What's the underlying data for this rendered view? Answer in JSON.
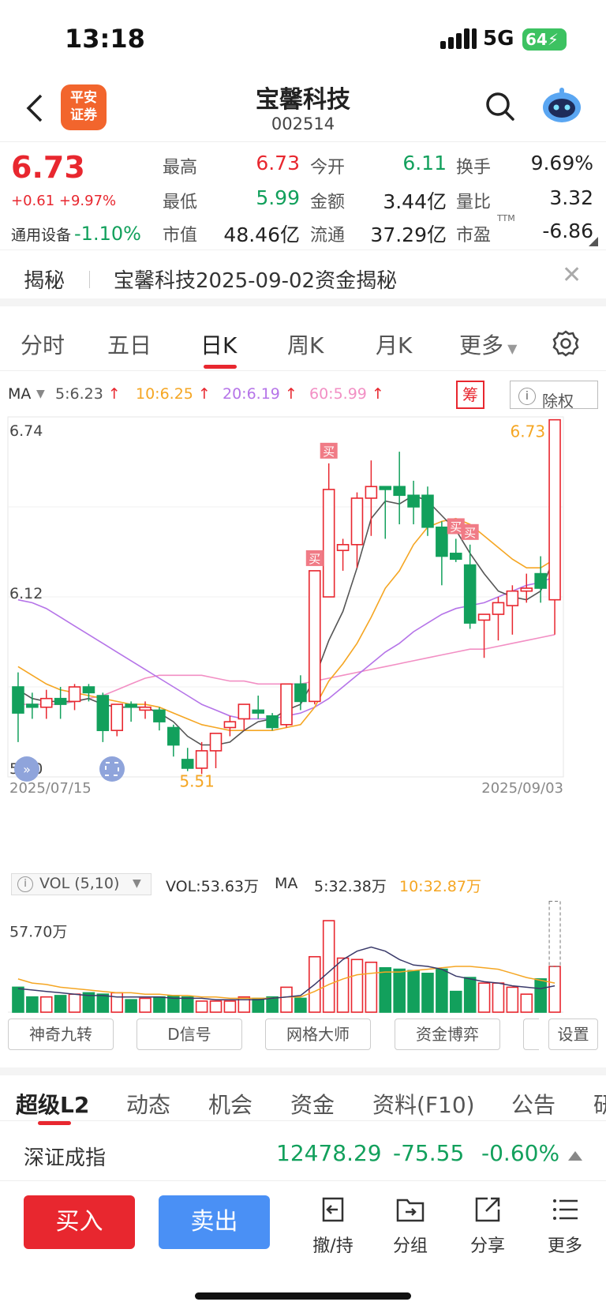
{
  "status": {
    "time": "13:18",
    "network": "5G",
    "battery": "64"
  },
  "header": {
    "logo_line1": "平安",
    "logo_line2": "证券",
    "title": "宝馨科技",
    "code": "002514"
  },
  "quote": {
    "price": "6.73",
    "change": "+0.61 +9.97%",
    "sector_name": "通用设备",
    "sector_change": "-1.10%",
    "rows": [
      [
        {
          "label": "最高",
          "value": "6.73",
          "color": "red"
        },
        {
          "label": "今开",
          "value": "6.11",
          "color": "green"
        },
        {
          "label": "换手",
          "value": "9.69%",
          "color": "black"
        }
      ],
      [
        {
          "label": "最低",
          "value": "5.99",
          "color": "green"
        },
        {
          "label": "金额",
          "value": "3.44亿",
          "color": "black"
        },
        {
          "label": "量比",
          "value": "3.32",
          "color": "black"
        }
      ],
      [
        {
          "label": "市值",
          "value": "48.46亿",
          "color": "black"
        },
        {
          "label": "流通",
          "value": "37.29亿",
          "color": "black"
        },
        {
          "label": "市盈",
          "value": "-6.86",
          "color": "black"
        }
      ]
    ],
    "pe_sup": "TTM"
  },
  "reveal": {
    "tag": "揭秘",
    "text": "宝馨科技2025-09-02资金揭秘"
  },
  "period_tabs": [
    "分时",
    "五日",
    "日K",
    "周K",
    "月K",
    "更多"
  ],
  "ma_legend": {
    "label": "MA",
    "items": [
      {
        "text": "5:6.23",
        "color": "#555555"
      },
      {
        "text": "10:6.25",
        "color": "#f5a623"
      },
      {
        "text": "20:6.19",
        "color": "#b574e8"
      },
      {
        "text": "60:5.99",
        "color": "#f28fc4"
      }
    ],
    "chou": "筹",
    "chuquan": "除权"
  },
  "colors": {
    "up": "#e8272f",
    "down": "#12a05c",
    "ma5": "#555555",
    "ma10": "#f5a623",
    "ma20": "#b574e8",
    "ma60": "#f28fc4"
  },
  "chart_data": [
    {
      "type": "candlestick",
      "title": "",
      "y_labels": [
        "6.74",
        "6.12",
        "5.50"
      ],
      "ylim": [
        5.5,
        6.74
      ],
      "x_start": "2025/07/15",
      "x_end": "2025/09/03",
      "high_label": "6.73",
      "low_label": "5.51",
      "buy_marker": "买",
      "candles": [
        {
          "o": 5.81,
          "h": 5.86,
          "l": 5.62,
          "c": 5.72
        },
        {
          "o": 5.75,
          "h": 5.79,
          "l": 5.7,
          "c": 5.74
        },
        {
          "o": 5.74,
          "h": 5.8,
          "l": 5.7,
          "c": 5.77
        },
        {
          "o": 5.77,
          "h": 5.81,
          "l": 5.7,
          "c": 5.75
        },
        {
          "o": 5.76,
          "h": 5.82,
          "l": 5.73,
          "c": 5.81
        },
        {
          "o": 5.81,
          "h": 5.82,
          "l": 5.76,
          "c": 5.79
        },
        {
          "o": 5.78,
          "h": 5.79,
          "l": 5.62,
          "c": 5.66
        },
        {
          "o": 5.66,
          "h": 5.75,
          "l": 5.64,
          "c": 5.75
        },
        {
          "o": 5.75,
          "h": 5.76,
          "l": 5.69,
          "c": 5.74
        },
        {
          "o": 5.73,
          "h": 5.76,
          "l": 5.7,
          "c": 5.74
        },
        {
          "o": 5.73,
          "h": 5.74,
          "l": 5.66,
          "c": 5.69
        },
        {
          "o": 5.67,
          "h": 5.68,
          "l": 5.57,
          "c": 5.61
        },
        {
          "o": 5.56,
          "h": 5.6,
          "l": 5.52,
          "c": 5.53
        },
        {
          "o": 5.53,
          "h": 5.62,
          "l": 5.51,
          "c": 5.59
        },
        {
          "o": 5.59,
          "h": 5.65,
          "l": 5.53,
          "c": 5.65
        },
        {
          "o": 5.67,
          "h": 5.71,
          "l": 5.64,
          "c": 5.69
        },
        {
          "o": 5.7,
          "h": 5.75,
          "l": 5.66,
          "c": 5.75
        },
        {
          "o": 5.73,
          "h": 5.78,
          "l": 5.7,
          "c": 5.72
        },
        {
          "o": 5.71,
          "h": 5.72,
          "l": 5.66,
          "c": 5.67
        },
        {
          "o": 5.68,
          "h": 5.82,
          "l": 5.67,
          "c": 5.82
        },
        {
          "o": 5.82,
          "h": 5.85,
          "l": 5.73,
          "c": 5.76
        },
        {
          "o": 5.76,
          "h": 6.21,
          "l": 5.75,
          "c": 6.21
        },
        {
          "o": 6.12,
          "h": 6.58,
          "l": 6.12,
          "c": 6.49
        },
        {
          "o": 6.28,
          "h": 6.32,
          "l": 6.21,
          "c": 6.3
        },
        {
          "o": 6.3,
          "h": 6.48,
          "l": 6.22,
          "c": 6.46
        },
        {
          "o": 6.46,
          "h": 6.59,
          "l": 6.33,
          "c": 6.5
        },
        {
          "o": 6.5,
          "h": 6.5,
          "l": 6.32,
          "c": 6.49
        },
        {
          "o": 6.5,
          "h": 6.62,
          "l": 6.37,
          "c": 6.47
        },
        {
          "o": 6.47,
          "h": 6.52,
          "l": 6.37,
          "c": 6.43
        },
        {
          "o": 6.47,
          "h": 6.5,
          "l": 6.33,
          "c": 6.36
        },
        {
          "o": 6.36,
          "h": 6.38,
          "l": 6.16,
          "c": 6.26
        },
        {
          "o": 6.27,
          "h": 6.32,
          "l": 6.24,
          "c": 6.25
        },
        {
          "o": 6.23,
          "h": 6.3,
          "l": 6.01,
          "c": 6.03
        },
        {
          "o": 6.04,
          "h": 6.06,
          "l": 5.91,
          "c": 6.06
        },
        {
          "o": 6.06,
          "h": 6.12,
          "l": 5.97,
          "c": 6.1
        },
        {
          "o": 6.09,
          "h": 6.16,
          "l": 5.99,
          "c": 6.14
        },
        {
          "o": 6.14,
          "h": 6.2,
          "l": 6.1,
          "c": 6.15
        },
        {
          "o": 6.2,
          "h": 6.26,
          "l": 6.1,
          "c": 6.15
        },
        {
          "o": 6.11,
          "h": 6.73,
          "l": 5.99,
          "c": 6.73
        }
      ],
      "ma5": [
        5.8,
        5.77,
        5.76,
        5.76,
        5.76,
        5.77,
        5.75,
        5.74,
        5.74,
        5.74,
        5.72,
        5.69,
        5.64,
        5.61,
        5.61,
        5.62,
        5.66,
        5.69,
        5.7,
        5.73,
        5.75,
        5.84,
        5.97,
        6.07,
        6.22,
        6.39,
        6.45,
        6.44,
        6.47,
        6.45,
        6.4,
        6.35,
        6.27,
        6.2,
        6.14,
        6.12,
        6.11,
        6.14,
        6.26
      ],
      "ma10": [
        5.88,
        5.85,
        5.82,
        5.8,
        5.79,
        5.78,
        5.77,
        5.76,
        5.75,
        5.75,
        5.74,
        5.72,
        5.7,
        5.68,
        5.67,
        5.66,
        5.66,
        5.66,
        5.66,
        5.67,
        5.68,
        5.74,
        5.83,
        5.89,
        5.96,
        6.05,
        6.15,
        6.21,
        6.3,
        6.36,
        6.38,
        6.39,
        6.37,
        6.33,
        6.29,
        6.25,
        6.22,
        6.22,
        6.25
      ],
      "ma20": [
        6.11,
        6.1,
        6.08,
        6.05,
        6.02,
        5.99,
        5.96,
        5.93,
        5.9,
        5.87,
        5.84,
        5.81,
        5.78,
        5.75,
        5.73,
        5.71,
        5.7,
        5.7,
        5.7,
        5.71,
        5.72,
        5.74,
        5.77,
        5.81,
        5.85,
        5.89,
        5.93,
        5.96,
        6.0,
        6.03,
        6.06,
        6.08,
        6.09,
        6.1,
        6.12,
        6.14,
        6.16,
        6.17,
        6.19
      ],
      "ma60": [
        5.75,
        5.75,
        5.75,
        5.75,
        5.76,
        5.77,
        5.78,
        5.8,
        5.82,
        5.84,
        5.85,
        5.85,
        5.85,
        5.85,
        5.84,
        5.83,
        5.83,
        5.82,
        5.82,
        5.82,
        5.82,
        5.83,
        5.84,
        5.85,
        5.86,
        5.87,
        5.88,
        5.89,
        5.9,
        5.91,
        5.92,
        5.93,
        5.94,
        5.94,
        5.95,
        5.96,
        5.97,
        5.98,
        5.99
      ],
      "buy_signals": [
        21,
        22,
        31,
        32
      ]
    },
    {
      "type": "bar",
      "title": "",
      "y_label_value": "57.70万",
      "ylim": [
        0,
        82
      ],
      "vol_values": [
        18,
        11,
        11,
        12,
        13,
        14,
        13,
        14,
        9,
        10,
        11,
        12,
        11,
        8,
        8,
        8,
        11,
        10,
        11,
        18,
        10,
        40,
        66,
        39,
        38,
        36,
        32,
        31,
        30,
        28,
        31,
        15,
        25,
        21,
        21,
        18,
        13,
        24,
        33
      ],
      "vol_ma5": [
        17,
        16,
        15,
        14,
        13,
        12,
        12,
        11,
        11,
        11,
        11,
        10,
        10,
        10,
        9,
        9,
        9,
        9,
        10,
        11,
        12,
        20,
        29,
        38,
        44,
        47,
        44,
        38,
        34,
        33,
        31,
        26,
        24,
        22,
        21,
        19,
        18,
        17,
        19
      ],
      "vol_ma10": [
        24,
        21,
        20,
        18,
        17,
        16,
        15,
        14,
        14,
        13,
        13,
        12,
        12,
        11,
        11,
        10,
        10,
        10,
        10,
        11,
        11,
        15,
        20,
        24,
        27,
        28,
        29,
        29,
        30,
        31,
        32,
        33,
        33,
        32,
        31,
        28,
        25,
        23,
        21
      ]
    }
  ],
  "vol_legend": {
    "name": "VOL (5,10)",
    "vol": "VOL:53.63万",
    "ma_label": "MA",
    "ma5": "5:32.38万",
    "ma10": "10:32.87万"
  },
  "indicator_buttons": [
    "神奇九转",
    "D信号",
    "网格大师",
    "资金博弈",
    "",
    "设置"
  ],
  "bottom_tabs": [
    "超级L2",
    "动态",
    "机会",
    "资金",
    "资料(F10)",
    "公告",
    "研"
  ],
  "index": {
    "name": "深证成指",
    "value": "12478.29",
    "change": "-75.55",
    "pct": "-0.60%"
  },
  "actions": {
    "buy": "买入",
    "sell": "卖出",
    "items": [
      "撤/持",
      "分组",
      "分享",
      "更多"
    ]
  }
}
